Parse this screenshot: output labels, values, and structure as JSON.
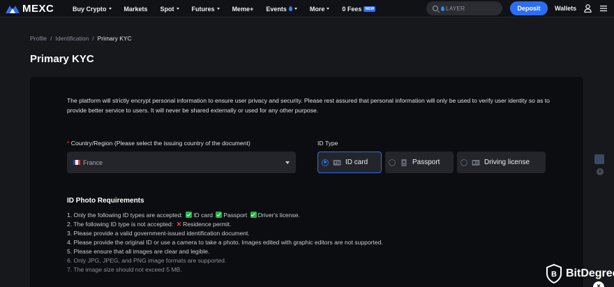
{
  "brand": {
    "name": "MEXC",
    "accent": "#2b6ef6"
  },
  "nav": {
    "items": [
      {
        "label": "Buy Crypto",
        "caret": true
      },
      {
        "label": "Markets",
        "caret": false
      },
      {
        "label": "Spot",
        "caret": true
      },
      {
        "label": "Futures",
        "caret": true
      },
      {
        "label": "Meme+",
        "caret": false
      },
      {
        "label": "Events",
        "caret": true,
        "icon": "drop-icon"
      },
      {
        "label": "More",
        "caret": true
      },
      {
        "label": "0 Fees",
        "caret": false,
        "badge": "NEW"
      }
    ],
    "search_value": "LAYER",
    "deposit_label": "Deposit",
    "wallets_label": "Wallets"
  },
  "breadcrumb": {
    "items": [
      "Profile",
      "Identification"
    ],
    "separator": "/",
    "current": "Primary KYC"
  },
  "page_title": "Primary KYC",
  "intro": "The platform will strictly encrypt personal information to ensure user privacy and security. Please rest assured that personal information will only be used to verify user identity so as to provide better service to users. It will never be shared externally or used for any other purpose.",
  "country": {
    "required_mark": "*",
    "label": "Country/Region (Please select the issuing country of the document)",
    "value": "France"
  },
  "id_type": {
    "label": "ID Type",
    "options": [
      {
        "label": "ID card",
        "selected": true,
        "icon": "id-card-icon"
      },
      {
        "label": "Passport",
        "selected": false,
        "icon": "passport-icon"
      },
      {
        "label": "Driving license",
        "selected": false,
        "icon": "driving-license-icon"
      }
    ]
  },
  "requirements": {
    "title": "ID Photo Requirements",
    "line1_prefix": "1. Only the following ID types are accepted:",
    "line1_items": [
      "ID card",
      "Passport",
      "Driver's license."
    ],
    "line2_prefix": "2. The following ID type is not accepted:",
    "line2_item": "Residence permit.",
    "lines": [
      "3. Please provide a valid government-issued identification document.",
      "4. Please provide the original ID or use a camera to take a photo. Images edited with graphic editors are not supported.",
      "5. Please ensure that all images are clear and legible.",
      "6. Only JPG, JPEG, and PNG image formats are supported.",
      "7. The image size should not exceed 5 MB."
    ]
  },
  "watermark": {
    "text": "BitDegree"
  }
}
